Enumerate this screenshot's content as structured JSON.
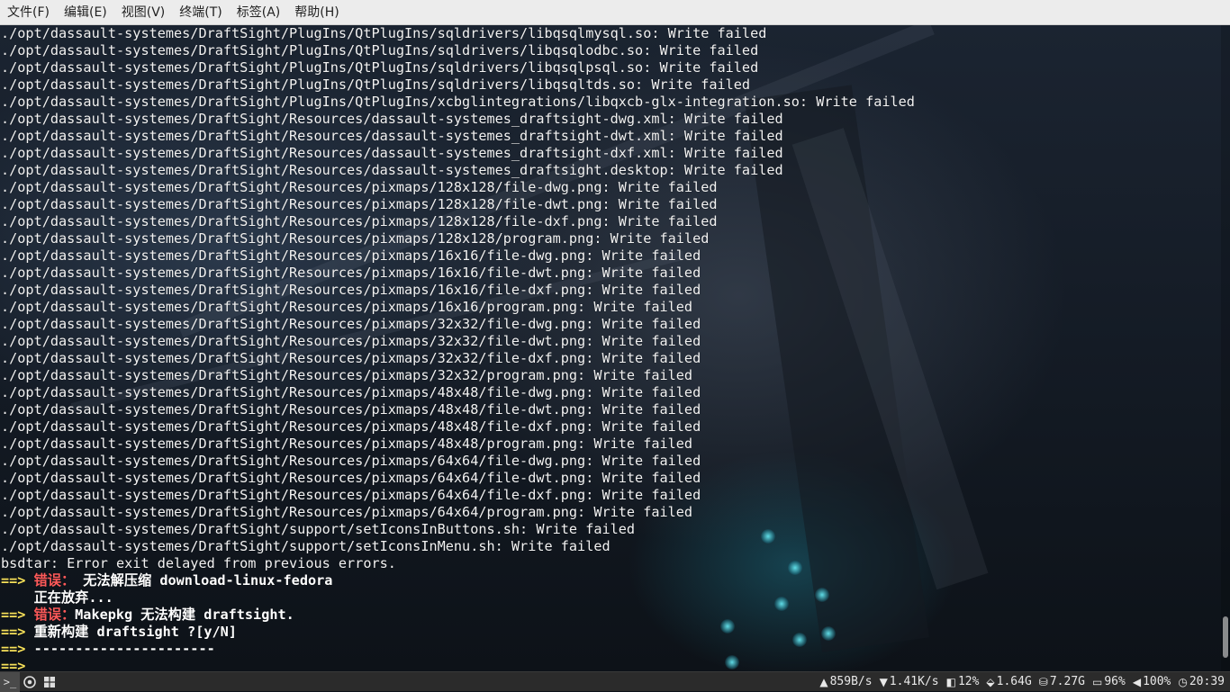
{
  "menubar": {
    "items": [
      "文件(F)",
      "编辑(E)",
      "视图(V)",
      "终端(T)",
      "标签(A)",
      "帮助(H)"
    ]
  },
  "terminal": {
    "plain_lines": [
      "./opt/dassault-systemes/DraftSight/PlugIns/QtPlugIns/sqldrivers/libqsqlmysql.so: Write failed",
      "./opt/dassault-systemes/DraftSight/PlugIns/QtPlugIns/sqldrivers/libqsqlodbc.so: Write failed",
      "./opt/dassault-systemes/DraftSight/PlugIns/QtPlugIns/sqldrivers/libqsqlpsql.so: Write failed",
      "./opt/dassault-systemes/DraftSight/PlugIns/QtPlugIns/sqldrivers/libqsqltds.so: Write failed",
      "./opt/dassault-systemes/DraftSight/PlugIns/QtPlugIns/xcbglintegrations/libqxcb-glx-integration.so: Write failed",
      "./opt/dassault-systemes/DraftSight/Resources/dassault-systemes_draftsight-dwg.xml: Write failed",
      "./opt/dassault-systemes/DraftSight/Resources/dassault-systemes_draftsight-dwt.xml: Write failed",
      "./opt/dassault-systemes/DraftSight/Resources/dassault-systemes_draftsight-dxf.xml: Write failed",
      "./opt/dassault-systemes/DraftSight/Resources/dassault-systemes_draftsight.desktop: Write failed",
      "./opt/dassault-systemes/DraftSight/Resources/pixmaps/128x128/file-dwg.png: Write failed",
      "./opt/dassault-systemes/DraftSight/Resources/pixmaps/128x128/file-dwt.png: Write failed",
      "./opt/dassault-systemes/DraftSight/Resources/pixmaps/128x128/file-dxf.png: Write failed",
      "./opt/dassault-systemes/DraftSight/Resources/pixmaps/128x128/program.png: Write failed",
      "./opt/dassault-systemes/DraftSight/Resources/pixmaps/16x16/file-dwg.png: Write failed",
      "./opt/dassault-systemes/DraftSight/Resources/pixmaps/16x16/file-dwt.png: Write failed",
      "./opt/dassault-systemes/DraftSight/Resources/pixmaps/16x16/file-dxf.png: Write failed",
      "./opt/dassault-systemes/DraftSight/Resources/pixmaps/16x16/program.png: Write failed",
      "./opt/dassault-systemes/DraftSight/Resources/pixmaps/32x32/file-dwg.png: Write failed",
      "./opt/dassault-systemes/DraftSight/Resources/pixmaps/32x32/file-dwt.png: Write failed",
      "./opt/dassault-systemes/DraftSight/Resources/pixmaps/32x32/file-dxf.png: Write failed",
      "./opt/dassault-systemes/DraftSight/Resources/pixmaps/32x32/program.png: Write failed",
      "./opt/dassault-systemes/DraftSight/Resources/pixmaps/48x48/file-dwg.png: Write failed",
      "./opt/dassault-systemes/DraftSight/Resources/pixmaps/48x48/file-dwt.png: Write failed",
      "./opt/dassault-systemes/DraftSight/Resources/pixmaps/48x48/file-dxf.png: Write failed",
      "./opt/dassault-systemes/DraftSight/Resources/pixmaps/48x48/program.png: Write failed",
      "./opt/dassault-systemes/DraftSight/Resources/pixmaps/64x64/file-dwg.png: Write failed",
      "./opt/dassault-systemes/DraftSight/Resources/pixmaps/64x64/file-dwt.png: Write failed",
      "./opt/dassault-systemes/DraftSight/Resources/pixmaps/64x64/file-dxf.png: Write failed",
      "./opt/dassault-systemes/DraftSight/Resources/pixmaps/64x64/program.png: Write failed",
      "./opt/dassault-systemes/DraftSight/support/setIconsInButtons.sh: Write failed",
      "./opt/dassault-systemes/DraftSight/support/setIconsInMenu.sh: Write failed",
      "bsdtar: Error exit delayed from previous errors."
    ],
    "error1": {
      "arrow": "==>",
      "label": " 错误：",
      "message": " 无法解压缩 download-linux-fedora"
    },
    "abort_line": "    正在放弃...",
    "error2": {
      "arrow": "==>",
      "label": " 错误：",
      "message": "Makepkg 无法构建 draftsight."
    },
    "prompt": {
      "arrow": "==>",
      "message": " 重新构建 draftsight ?[y/N]"
    },
    "separator": {
      "arrow": "==>",
      "message": " ----------------------"
    },
    "input_line": {
      "arrow": "==>",
      "message": ""
    }
  },
  "taskbar": {
    "terminal_launcher": ">_",
    "stats": {
      "upload": "859B/s",
      "download": "1.41K/s",
      "cpu": "12%",
      "memory": "1.64G",
      "disk": "7.27G",
      "battery": "96%",
      "volume": "100%",
      "clock": "20:39"
    }
  },
  "colors": {
    "error_red": "#ff5a5a",
    "arrow_yellow": "#f7e15a",
    "menubar_bg": "#ececec",
    "taskbar_bg": "#2b2b2b"
  }
}
